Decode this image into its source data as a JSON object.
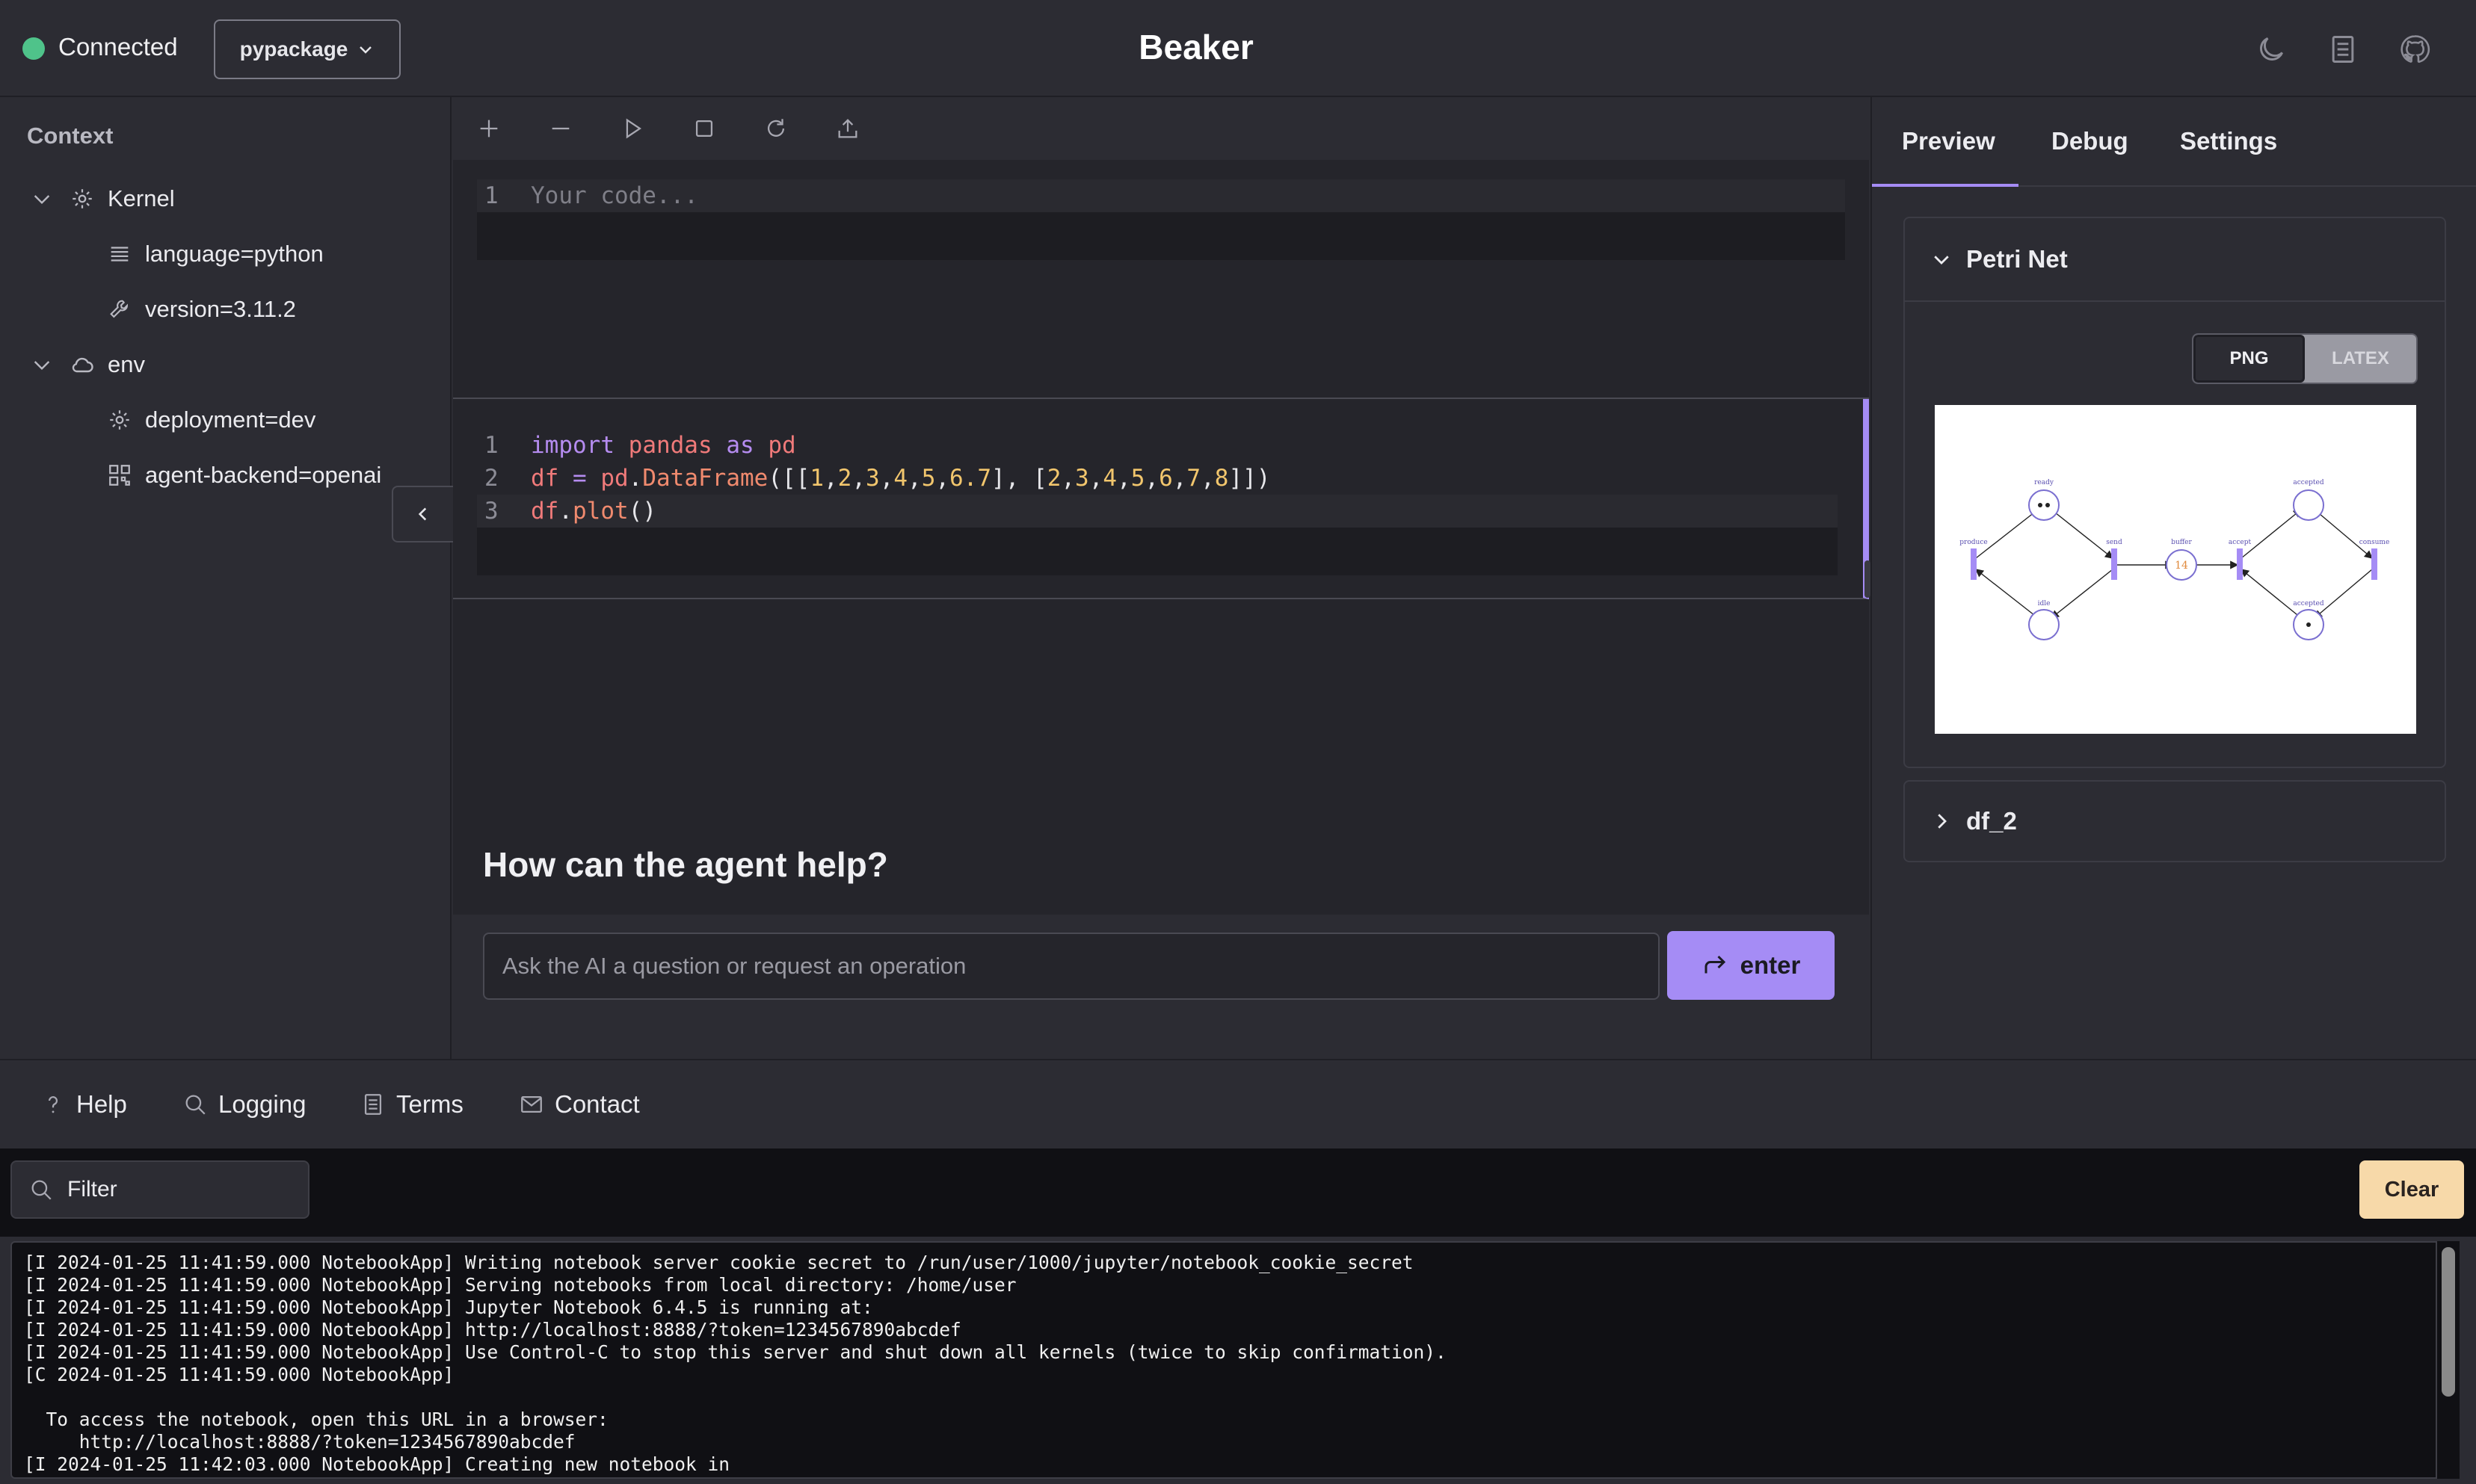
{
  "header": {
    "status": "Connected",
    "package": "pypackage",
    "title": "Beaker"
  },
  "sidebar": {
    "title": "Context",
    "groups": [
      {
        "label": "Kernel",
        "icon": "gear-icon",
        "items": [
          {
            "label": "language=python",
            "icon": "list-icon"
          },
          {
            "label": "version=3.11.2",
            "icon": "wrench-icon"
          }
        ]
      },
      {
        "label": "env",
        "icon": "cloud-icon",
        "items": [
          {
            "label": "deployment=dev",
            "icon": "gear-icon"
          },
          {
            "label": "agent-backend=openai",
            "icon": "grid-icon"
          }
        ]
      }
    ]
  },
  "notebook": {
    "cell1": {
      "placeholder": "Your code..."
    },
    "cell2": {
      "lines": [
        "import pandas as pd",
        "df = pd.DataFrame([[1,2,3,4,5,6.7], [2,3,4,5,6,7,8]])",
        "df.plot()"
      ]
    },
    "agent": {
      "title": "How can the agent help?",
      "placeholder": "Ask the AI a question or request an operation",
      "enter_label": "enter"
    }
  },
  "right_panel": {
    "tabs": [
      "Preview",
      "Debug",
      "Settings"
    ],
    "active_tab": "Preview",
    "petri": {
      "title": "Petri Net",
      "format_options": [
        "PNG",
        "LATEX"
      ],
      "selected_format": "PNG",
      "image_labels": {
        "ready": "ready",
        "idle": "idle",
        "produce": "produce",
        "send": "send",
        "buffer": "buffer",
        "buffer_tokens": "14",
        "accept": "accept",
        "accepted_top": "accepted",
        "accepted_bottom": "accepted",
        "consume": "consume"
      }
    },
    "df2": {
      "title": "df_2"
    }
  },
  "footer": {
    "tabs": [
      "Help",
      "Logging",
      "Terms",
      "Contact"
    ]
  },
  "logs": {
    "filter_placeholder": "Filter",
    "clear_label": "Clear",
    "lines": [
      "[I 2024-01-25 11:41:59.000 NotebookApp] Writing notebook server cookie secret to /run/user/1000/jupyter/notebook_cookie_secret",
      "[I 2024-01-25 11:41:59.000 NotebookApp] Serving notebooks from local directory: /home/user",
      "[I 2024-01-25 11:41:59.000 NotebookApp] Jupyter Notebook 6.4.5 is running at:",
      "[I 2024-01-25 11:41:59.000 NotebookApp] http://localhost:8888/?token=1234567890abcdef",
      "[I 2024-01-25 11:41:59.000 NotebookApp] Use Control-C to stop this server and shut down all kernels (twice to skip confirmation).",
      "[C 2024-01-25 11:41:59.000 NotebookApp]",
      "",
      "  To access the notebook, open this URL in a browser:",
      "     http://localhost:8888/?token=1234567890abcdef",
      "[I 2024-01-25 11:42:03.000 NotebookApp] Creating new notebook in"
    ]
  },
  "colors": {
    "accent": "#a58cf5",
    "status_ok": "#4fc38a",
    "clear_button": "#f7d9a9",
    "background": "#2c2c33"
  }
}
